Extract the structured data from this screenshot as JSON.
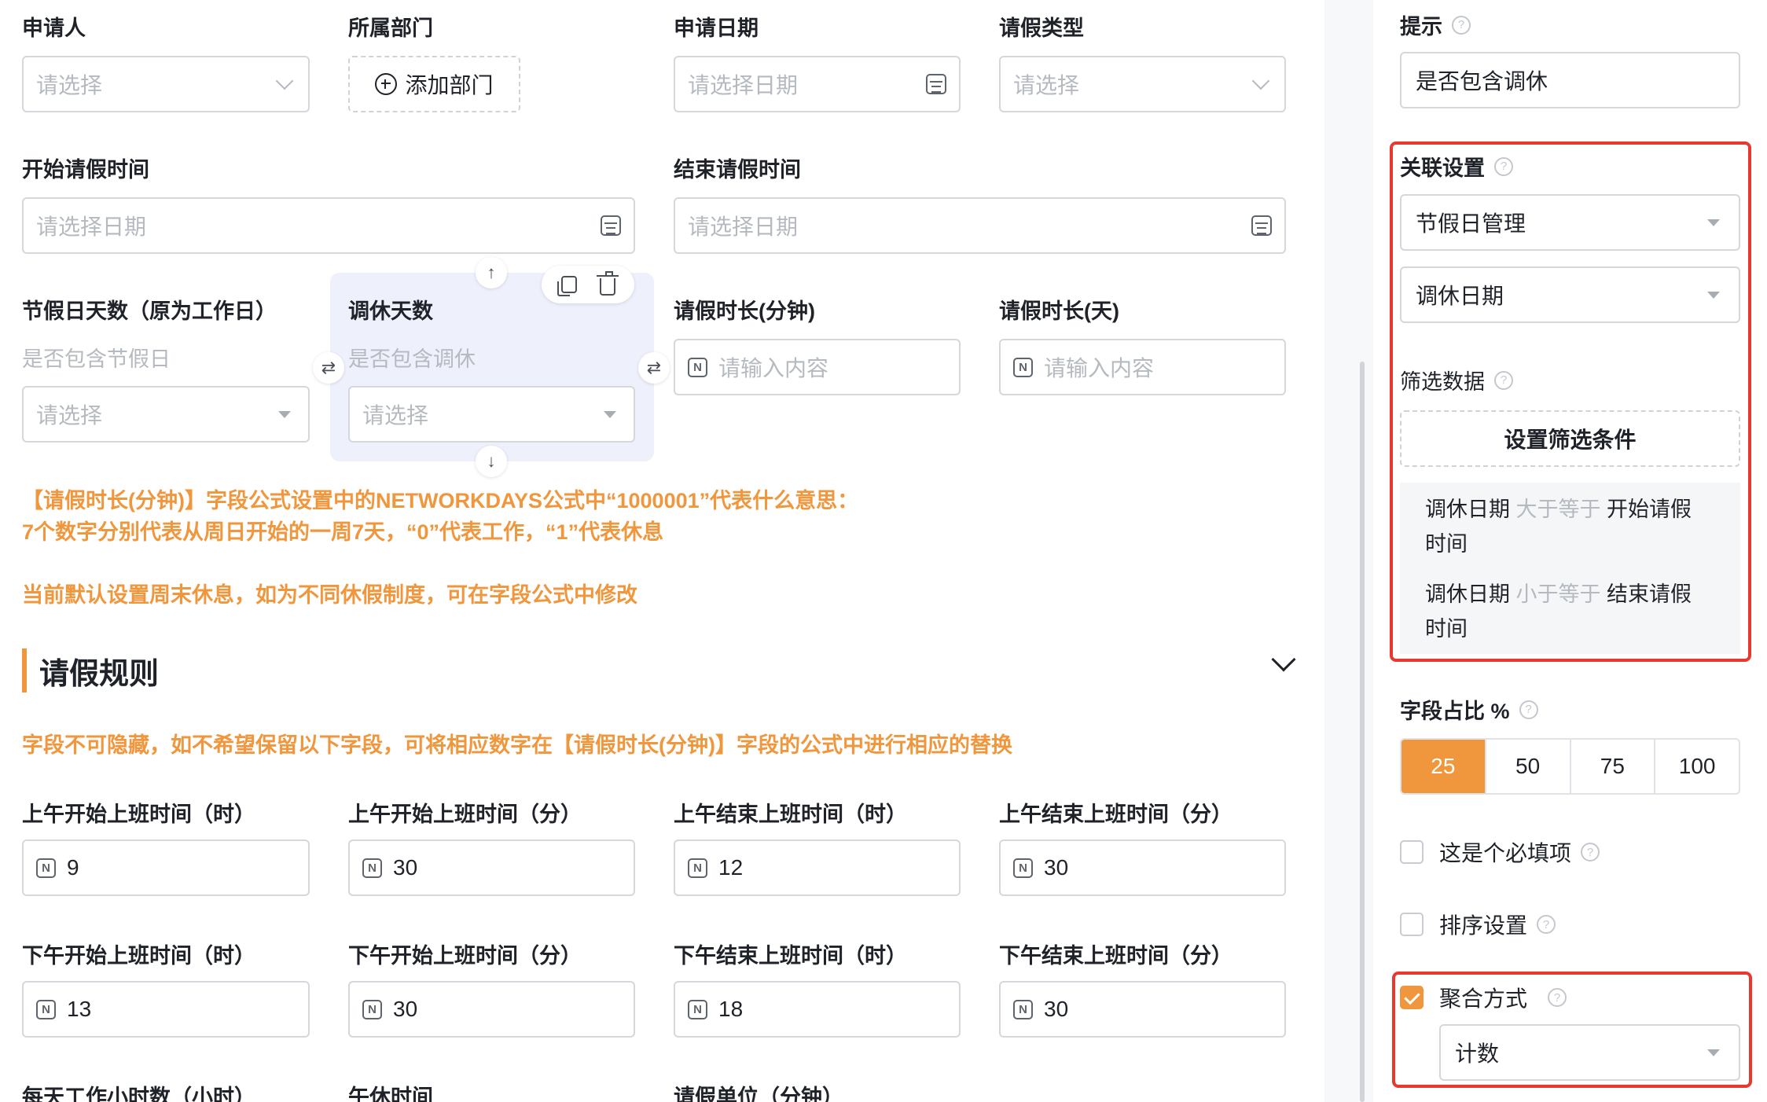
{
  "form": {
    "row1": [
      {
        "label": "申请人",
        "placeholder": "请选择"
      },
      {
        "label": "所属部门",
        "button": "添加部门"
      },
      {
        "label": "申请日期",
        "placeholder": "请选择日期"
      },
      {
        "label": "请假类型",
        "placeholder": "请选择"
      }
    ],
    "row2": [
      {
        "label": "开始请假时间",
        "placeholder": "请选择日期"
      },
      {
        "label": "结束请假时间",
        "placeholder": "请选择日期"
      }
    ],
    "row3": [
      {
        "label": "节假日天数（原为工作日）",
        "hint": "是否包含节假日",
        "placeholder": "请选择"
      },
      {
        "label": "调休天数",
        "hint": "是否包含调休",
        "placeholder": "请选择"
      },
      {
        "label": "请假时长(分钟)",
        "placeholder": "请输入内容"
      },
      {
        "label": "请假时长(天)",
        "placeholder": "请输入内容"
      }
    ],
    "notes": [
      "【请假时长(分钟)】字段公式设置中的NETWORKDAYS公式中“1000001”代表什么意思：",
      "7个数字分别代表从周日开始的一周7天，“0”代表工作，“1”代表休息",
      "当前默认设置周末休息，如为不同休假制度，可在字段公式中修改"
    ],
    "section_title": "请假规则",
    "section_note": "字段不可隐藏，如不希望保留以下字段，可将相应数字在【请假时长(分钟)】字段的公式中进行相应的替换",
    "rule_rows": [
      [
        {
          "label": "上午开始上班时间（时）",
          "value": "9"
        },
        {
          "label": "上午开始上班时间（分）",
          "value": "30"
        },
        {
          "label": "上午结束上班时间（时）",
          "value": "12"
        },
        {
          "label": "上午结束上班时间（分）",
          "value": "30"
        }
      ],
      [
        {
          "label": "下午开始上班时间（时）",
          "value": "13"
        },
        {
          "label": "下午开始上班时间（分）",
          "value": "30"
        },
        {
          "label": "下午结束上班时间（时）",
          "value": "18"
        },
        {
          "label": "下午结束上班时间（分）",
          "value": "30"
        }
      ]
    ],
    "last_row": [
      "每天工作小时数（小时）",
      "午休时间",
      "请假单位（分钟）"
    ],
    "number_icon_glyph": "N"
  },
  "panel": {
    "hint_label": "提示",
    "hint_value": "是否包含调休",
    "link_label": "关联设置",
    "link_source": "节假日管理",
    "link_field": "调休日期",
    "filter_label": "筛选数据",
    "filter_button": "设置筛选条件",
    "conditions": [
      {
        "field": "调休日期",
        "op": "大于等于",
        "target": "开始请假",
        "wrap": "时间"
      },
      {
        "field": "调休日期",
        "op": "小于等于",
        "target": "结束请假",
        "wrap": "时间"
      }
    ],
    "ratio_label": "字段占比 %",
    "ratio_options": [
      "25",
      "50",
      "75",
      "100"
    ],
    "ratio_selected": "25",
    "required_label": "这是个必填项",
    "sort_label": "排序设置",
    "agg_label": "聚合方式",
    "agg_value": "计数",
    "question_glyph": "?"
  },
  "colors": {
    "accent": "#f0963c",
    "highlight_border": "#e8382f",
    "selected_card": "#eef0fb"
  }
}
